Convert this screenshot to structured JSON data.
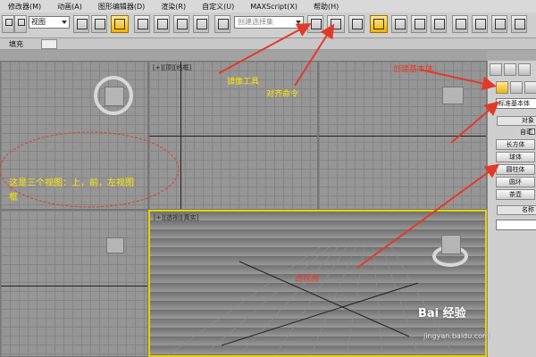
{
  "menubar": {
    "items": [
      {
        "label": "修改器(M)"
      },
      {
        "label": "动画(A)"
      },
      {
        "label": "图形编辑器(D)"
      },
      {
        "label": "渲染(R)"
      },
      {
        "label": "自定义(U)"
      },
      {
        "label": "MAXScript(X)"
      },
      {
        "label": "帮助(H)"
      }
    ]
  },
  "toolbar": {
    "view_select": "视图",
    "selection_set_placeholder": "创建选择集"
  },
  "ribbon": {
    "label": "填充"
  },
  "viewports": {
    "top_label": "[+][顶][线框]",
    "perspective_label": "[+][透视][真实]"
  },
  "command_panel": {
    "category_dropdown": "标准基本体",
    "object_type_header": "对象",
    "autogrid_label": "自动",
    "buttons": [
      {
        "label": "长方体"
      },
      {
        "label": "球体"
      },
      {
        "label": "圆柱体"
      },
      {
        "label": "圆环"
      },
      {
        "label": "茶壶"
      }
    ],
    "name_color_header": "名称"
  },
  "annotations": {
    "mirror": "镜像工具",
    "align": "对齐命令",
    "views": "这是三个视图：上，前，左视图",
    "views_2": "框",
    "perspective": "透视图",
    "panel_text": "创建基本体"
  },
  "watermark": {
    "brand": "Bai 经验",
    "url": "jingyan.baidu.com"
  },
  "colors": {
    "annotation_yellow": "#ffe600",
    "annotation_red": "#e23a2a",
    "active_viewport_border": "#e8d000"
  }
}
